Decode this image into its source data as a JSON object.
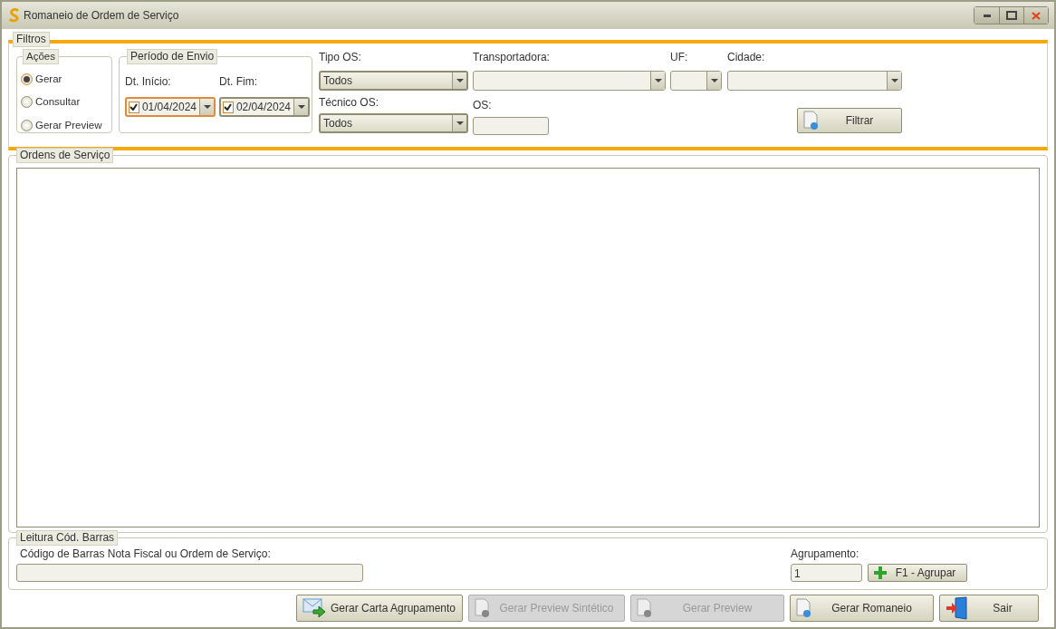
{
  "window": {
    "title": "Romaneio de Ordem de Serviço"
  },
  "filters": {
    "legend": "Filtros",
    "actions": {
      "legend": "Ações",
      "options": [
        {
          "label": "Gerar",
          "selected": true
        },
        {
          "label": "Consultar",
          "selected": false
        },
        {
          "label": "Gerar Preview",
          "selected": false
        }
      ]
    },
    "period": {
      "legend": "Período de Envio",
      "fields": [
        {
          "label": "Dt. Início:",
          "value": "01/04/2024",
          "checked": true,
          "focused": true
        },
        {
          "label": "Dt. Fim:",
          "value": "02/04/2024",
          "checked": true,
          "focused": false
        }
      ]
    },
    "tipo_os": {
      "label": "Tipo OS:",
      "value": "Todos"
    },
    "transportadora": {
      "label": "Transportadora:"
    },
    "uf": {
      "label": "UF:"
    },
    "cidade": {
      "label": "Cidade:"
    },
    "tecnico_os": {
      "label": "Técnico OS:",
      "value": "Todos"
    },
    "os": {
      "label": "OS:"
    },
    "filter_button": "Filtrar"
  },
  "orders": {
    "legend": "Ordens de Serviço"
  },
  "barcode": {
    "legend": "Leitura Cód. Barras",
    "label": "Código de Barras Nota Fiscal ou Ordem de Serviço:",
    "grouping": {
      "label": "Agrupamento:",
      "value": "1"
    },
    "group_button": "F1 - Agrupar"
  },
  "buttons": [
    {
      "label": "Gerar Carta Agrupamento",
      "kind": "letter",
      "disabled": false
    },
    {
      "label": "Gerar Preview Sintético",
      "kind": "document",
      "disabled": true
    },
    {
      "label": "Gerar Preview",
      "kind": "document",
      "disabled": true
    },
    {
      "label": "Gerar Romaneio",
      "kind": "document",
      "disabled": false
    },
    {
      "label": "Sair",
      "kind": "exit",
      "disabled": false
    }
  ]
}
